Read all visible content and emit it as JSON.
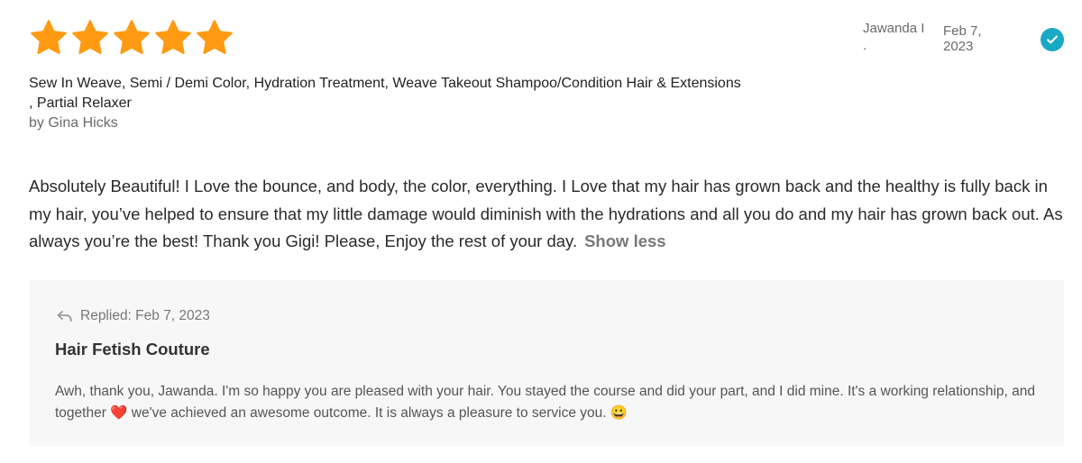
{
  "review": {
    "rating": 5,
    "star_count": 5,
    "star_color": "#ff9a12",
    "reviewer_name": "Jawanda I",
    "reviewer_dot": ".",
    "date_line1": "Feb 7,",
    "date_line2": "2023",
    "verified_icon": "check-circle-icon",
    "verified_color": "#1aa9c4",
    "services_line1": "Sew In Weave, Semi / Demi Color, Hydration Treatment, Weave Takeout Shampoo/Condition Hair & Extensions",
    "services_line2": ", Partial Relaxer",
    "by_line": "by Gina Hicks",
    "body": "Absolutely Beautiful! I Love the bounce, and body, the color, everything. I Love that my hair has grown back and the healthy is fully back in my hair, you’ve helped to ensure that my little damage would diminish with the hydrations and all you do and my hair has grown back out. As always you’re the best! Thank you Gigi! Please, Enjoy the rest of your day.",
    "show_less_label": "Show less"
  },
  "reply": {
    "reply_icon": "reply-arrow-icon",
    "replied_label": "Replied: Feb 7, 2023",
    "business_name": "Hair Fetish Couture",
    "text_part1": "Awh, thank you, Jawanda. I'm so happy you are pleased with your hair. You stayed the course and did your part, and I did mine. It's a working relationship, and together ",
    "heart_emoji": "❤️",
    "text_part2": " we've achieved an awesome outcome. It is always a pleasure to service you. ",
    "smile_emoji": "😀"
  }
}
